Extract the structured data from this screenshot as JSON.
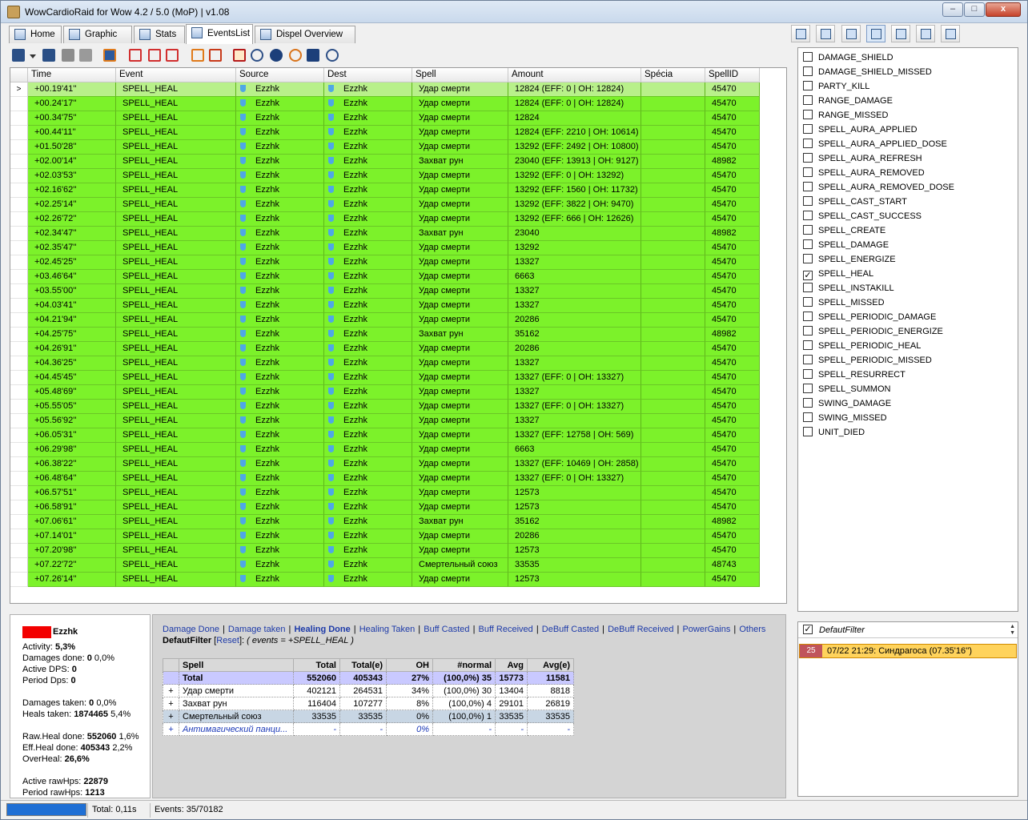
{
  "window": {
    "title": "WowCardioRaid for Wow 4.2 / 5.0 (MoP) | v1.08",
    "min_glyph": "–",
    "max_glyph": "□",
    "close_glyph": "x"
  },
  "tabs": [
    {
      "label": "Home"
    },
    {
      "label": "Graphic"
    },
    {
      "label": "Stats"
    },
    {
      "label": "EventsList"
    },
    {
      "label": "Dispel Overview"
    }
  ],
  "active_tab": "EventsList",
  "grid": {
    "columns": [
      "Time",
      "Event",
      "Source",
      "Dest",
      "Spell",
      "Amount",
      "Spécia",
      "SpellID"
    ],
    "current_row_marker": ">",
    "rows": [
      [
        "+00.19'41''",
        "SPELL_HEAL",
        "Ezzhk",
        "Ezzhk",
        "Удар смерти",
        "12824 (EFF: 0 | OH: 12824)",
        "",
        "45470"
      ],
      [
        "+00.24'17''",
        "SPELL_HEAL",
        "Ezzhk",
        "Ezzhk",
        "Удар смерти",
        "12824 (EFF: 0 | OH: 12824)",
        "",
        "45470"
      ],
      [
        "+00.34'75''",
        "SPELL_HEAL",
        "Ezzhk",
        "Ezzhk",
        "Удар смерти",
        "12824",
        "",
        "45470"
      ],
      [
        "+00.44'11''",
        "SPELL_HEAL",
        "Ezzhk",
        "Ezzhk",
        "Удар смерти",
        "12824 (EFF: 2210 | OH: 10614)",
        "",
        "45470"
      ],
      [
        "+01.50'28''",
        "SPELL_HEAL",
        "Ezzhk",
        "Ezzhk",
        "Удар смерти",
        "13292 (EFF: 2492 | OH: 10800)",
        "",
        "45470"
      ],
      [
        "+02.00'14''",
        "SPELL_HEAL",
        "Ezzhk",
        "Ezzhk",
        "Захват рун",
        "23040 (EFF: 13913 | OH: 9127)",
        "",
        "48982"
      ],
      [
        "+02.03'53''",
        "SPELL_HEAL",
        "Ezzhk",
        "Ezzhk",
        "Удар смерти",
        "13292 (EFF: 0 | OH: 13292)",
        "",
        "45470"
      ],
      [
        "+02.16'62''",
        "SPELL_HEAL",
        "Ezzhk",
        "Ezzhk",
        "Удар смерти",
        "13292 (EFF: 1560 | OH: 11732)",
        "",
        "45470"
      ],
      [
        "+02.25'14''",
        "SPELL_HEAL",
        "Ezzhk",
        "Ezzhk",
        "Удар смерти",
        "13292 (EFF: 3822 | OH: 9470)",
        "",
        "45470"
      ],
      [
        "+02.26'72''",
        "SPELL_HEAL",
        "Ezzhk",
        "Ezzhk",
        "Удар смерти",
        "13292 (EFF: 666 | OH: 12626)",
        "",
        "45470"
      ],
      [
        "+02.34'47''",
        "SPELL_HEAL",
        "Ezzhk",
        "Ezzhk",
        "Захват рун",
        "23040",
        "",
        "48982"
      ],
      [
        "+02.35'47''",
        "SPELL_HEAL",
        "Ezzhk",
        "Ezzhk",
        "Удар смерти",
        "13292",
        "",
        "45470"
      ],
      [
        "+02.45'25''",
        "SPELL_HEAL",
        "Ezzhk",
        "Ezzhk",
        "Удар смерти",
        "13327",
        "",
        "45470"
      ],
      [
        "+03.46'64''",
        "SPELL_HEAL",
        "Ezzhk",
        "Ezzhk",
        "Удар смерти",
        "6663",
        "",
        "45470"
      ],
      [
        "+03.55'00''",
        "SPELL_HEAL",
        "Ezzhk",
        "Ezzhk",
        "Удар смерти",
        "13327",
        "",
        "45470"
      ],
      [
        "+04.03'41''",
        "SPELL_HEAL",
        "Ezzhk",
        "Ezzhk",
        "Удар смерти",
        "13327",
        "",
        "45470"
      ],
      [
        "+04.21'94''",
        "SPELL_HEAL",
        "Ezzhk",
        "Ezzhk",
        "Удар смерти",
        "20286",
        "",
        "45470"
      ],
      [
        "+04.25'75''",
        "SPELL_HEAL",
        "Ezzhk",
        "Ezzhk",
        "Захват рун",
        "35162",
        "",
        "48982"
      ],
      [
        "+04.26'91''",
        "SPELL_HEAL",
        "Ezzhk",
        "Ezzhk",
        "Удар смерти",
        "20286",
        "",
        "45470"
      ],
      [
        "+04.36'25''",
        "SPELL_HEAL",
        "Ezzhk",
        "Ezzhk",
        "Удар смерти",
        "13327",
        "",
        "45470"
      ],
      [
        "+04.45'45''",
        "SPELL_HEAL",
        "Ezzhk",
        "Ezzhk",
        "Удар смерти",
        "13327 (EFF: 0 | OH: 13327)",
        "",
        "45470"
      ],
      [
        "+05.48'69''",
        "SPELL_HEAL",
        "Ezzhk",
        "Ezzhk",
        "Удар смерти",
        "13327",
        "",
        "45470"
      ],
      [
        "+05.55'05''",
        "SPELL_HEAL",
        "Ezzhk",
        "Ezzhk",
        "Удар смерти",
        "13327 (EFF: 0 | OH: 13327)",
        "",
        "45470"
      ],
      [
        "+05.56'92''",
        "SPELL_HEAL",
        "Ezzhk",
        "Ezzhk",
        "Удар смерти",
        "13327",
        "",
        "45470"
      ],
      [
        "+06.05'31''",
        "SPELL_HEAL",
        "Ezzhk",
        "Ezzhk",
        "Удар смерти",
        "13327 (EFF: 12758 | OH: 569)",
        "",
        "45470"
      ],
      [
        "+06.29'98''",
        "SPELL_HEAL",
        "Ezzhk",
        "Ezzhk",
        "Удар смерти",
        "6663",
        "",
        "45470"
      ],
      [
        "+06.38'22''",
        "SPELL_HEAL",
        "Ezzhk",
        "Ezzhk",
        "Удар смерти",
        "13327 (EFF: 10469 | OH: 2858)",
        "",
        "45470"
      ],
      [
        "+06.48'64''",
        "SPELL_HEAL",
        "Ezzhk",
        "Ezzhk",
        "Удар смерти",
        "13327 (EFF: 0 | OH: 13327)",
        "",
        "45470"
      ],
      [
        "+06.57'51''",
        "SPELL_HEAL",
        "Ezzhk",
        "Ezzhk",
        "Удар смерти",
        "12573",
        "",
        "45470"
      ],
      [
        "+06.58'91''",
        "SPELL_HEAL",
        "Ezzhk",
        "Ezzhk",
        "Удар смерти",
        "12573",
        "",
        "45470"
      ],
      [
        "+07.06'61''",
        "SPELL_HEAL",
        "Ezzhk",
        "Ezzhk",
        "Захват рун",
        "35162",
        "",
        "48982"
      ],
      [
        "+07.14'01''",
        "SPELL_HEAL",
        "Ezzhk",
        "Ezzhk",
        "Удар смерти",
        "20286",
        "",
        "45470"
      ],
      [
        "+07.20'98''",
        "SPELL_HEAL",
        "Ezzhk",
        "Ezzhk",
        "Удар смерти",
        "12573",
        "",
        "45470"
      ],
      [
        "+07.22'72''",
        "SPELL_HEAL",
        "Ezzhk",
        "Ezzhk",
        "Смертельный союз",
        "33535",
        "",
        "48743"
      ],
      [
        "+07.26'14''",
        "SPELL_HEAL",
        "Ezzhk",
        "Ezzhk",
        "Удар смерти",
        "12573",
        "",
        "45470"
      ]
    ]
  },
  "event_filters": [
    {
      "label": "DAMAGE_SHIELD",
      "checked": false
    },
    {
      "label": "DAMAGE_SHIELD_MISSED",
      "checked": false
    },
    {
      "label": "PARTY_KILL",
      "checked": false
    },
    {
      "label": "RANGE_DAMAGE",
      "checked": false
    },
    {
      "label": "RANGE_MISSED",
      "checked": false
    },
    {
      "label": "SPELL_AURA_APPLIED",
      "checked": false
    },
    {
      "label": "SPELL_AURA_APPLIED_DOSE",
      "checked": false
    },
    {
      "label": "SPELL_AURA_REFRESH",
      "checked": false
    },
    {
      "label": "SPELL_AURA_REMOVED",
      "checked": false
    },
    {
      "label": "SPELL_AURA_REMOVED_DOSE",
      "checked": false
    },
    {
      "label": "SPELL_CAST_START",
      "checked": false
    },
    {
      "label": "SPELL_CAST_SUCCESS",
      "checked": false
    },
    {
      "label": "SPELL_CREATE",
      "checked": false
    },
    {
      "label": "SPELL_DAMAGE",
      "checked": false
    },
    {
      "label": "SPELL_ENERGIZE",
      "checked": false
    },
    {
      "label": "SPELL_HEAL",
      "checked": true
    },
    {
      "label": "SPELL_INSTAKILL",
      "checked": false
    },
    {
      "label": "SPELL_MISSED",
      "checked": false
    },
    {
      "label": "SPELL_PERIODIC_DAMAGE",
      "checked": false
    },
    {
      "label": "SPELL_PERIODIC_ENERGIZE",
      "checked": false
    },
    {
      "label": "SPELL_PERIODIC_HEAL",
      "checked": false
    },
    {
      "label": "SPELL_PERIODIC_MISSED",
      "checked": false
    },
    {
      "label": "SPELL_RESURRECT",
      "checked": false
    },
    {
      "label": "SPELL_SUMMON",
      "checked": false
    },
    {
      "label": "SWING_DAMAGE",
      "checked": false
    },
    {
      "label": "SWING_MISSED",
      "checked": false
    },
    {
      "label": "UNIT_DIED",
      "checked": false
    }
  ],
  "player": {
    "name": "Ezzhk",
    "color": "#f30000",
    "stats": [
      {
        "label": "Activity: ",
        "value": "5,3%",
        "extra": ""
      },
      {
        "label": "Damages done: ",
        "value": "0",
        "extra": " 0,0%"
      },
      {
        "label": "Active DPS: ",
        "value": "0",
        "extra": ""
      },
      {
        "label": "Period Dps: ",
        "value": "0",
        "extra": ""
      },
      {
        "label": "",
        "value": "",
        "extra": ""
      },
      {
        "label": "Damages taken: ",
        "value": "0",
        "extra": " 0,0%"
      },
      {
        "label": "Heals taken: ",
        "value": "1874465",
        "extra": " 5,4%"
      },
      {
        "label": "",
        "value": "",
        "extra": ""
      },
      {
        "label": "Raw.Heal done: ",
        "value": "552060",
        "extra": " 1,6%"
      },
      {
        "label": "Eff.Heal done: ",
        "value": "405343",
        "extra": " 2,2%"
      },
      {
        "label": "OverHeal: ",
        "value": "26,6%",
        "extra": ""
      },
      {
        "label": "",
        "value": "",
        "extra": ""
      },
      {
        "label": "Active rawHps: ",
        "value": "22879",
        "extra": ""
      },
      {
        "label": "Period rawHps: ",
        "value": "1213",
        "extra": ""
      }
    ]
  },
  "report": {
    "links": [
      {
        "label": "Damage Done",
        "active": false
      },
      {
        "label": "Damage taken",
        "active": false
      },
      {
        "label": "Healing Done",
        "active": true
      },
      {
        "label": "Healing Taken",
        "active": false
      },
      {
        "label": "Buff Casted",
        "active": false
      },
      {
        "label": "Buff Received",
        "active": false
      },
      {
        "label": "DeBuff Casted",
        "active": false
      },
      {
        "label": "DeBuff Received",
        "active": false
      },
      {
        "label": "PowerGains",
        "active": false
      },
      {
        "label": "Others",
        "active": false
      }
    ],
    "filter_name": "DefautFilter",
    "reset_label": "Reset",
    "filter_expr": "( events = +SPELL_HEAL )",
    "table": {
      "columns": [
        "",
        "Spell",
        "Total",
        "Total(e)",
        "OH",
        "#normal",
        "Avg",
        "Avg(e)"
      ],
      "total": [
        "",
        "Total",
        "552060",
        "405343",
        "27%",
        "(100,0%)  35",
        "15773",
        "11581"
      ],
      "rows": [
        [
          "+",
          "Удар смерти",
          "402121",
          "264531",
          "34%",
          "(100,0%)  30",
          "13404",
          "8818"
        ],
        [
          "+",
          "Захват рун",
          "116404",
          "107277",
          "8%",
          "(100,0%)  4",
          "29101",
          "26819"
        ],
        [
          "+",
          "Смертельный союз",
          "33535",
          "33535",
          "0%",
          "(100,0%)  1",
          "33535",
          "33535"
        ],
        [
          "+",
          "Антимагический панци...",
          "-",
          "-",
          "0%",
          "-",
          "-",
          "-"
        ]
      ]
    }
  },
  "filter_combo": {
    "label": "DefautFilter",
    "checked": true
  },
  "encounter": {
    "number": "25",
    "label": "07/22  21:29: Синдрагоса (07.35'16'')"
  },
  "statusbar": {
    "total": "Total: 0,11s",
    "events": "Events: 35/70182"
  }
}
